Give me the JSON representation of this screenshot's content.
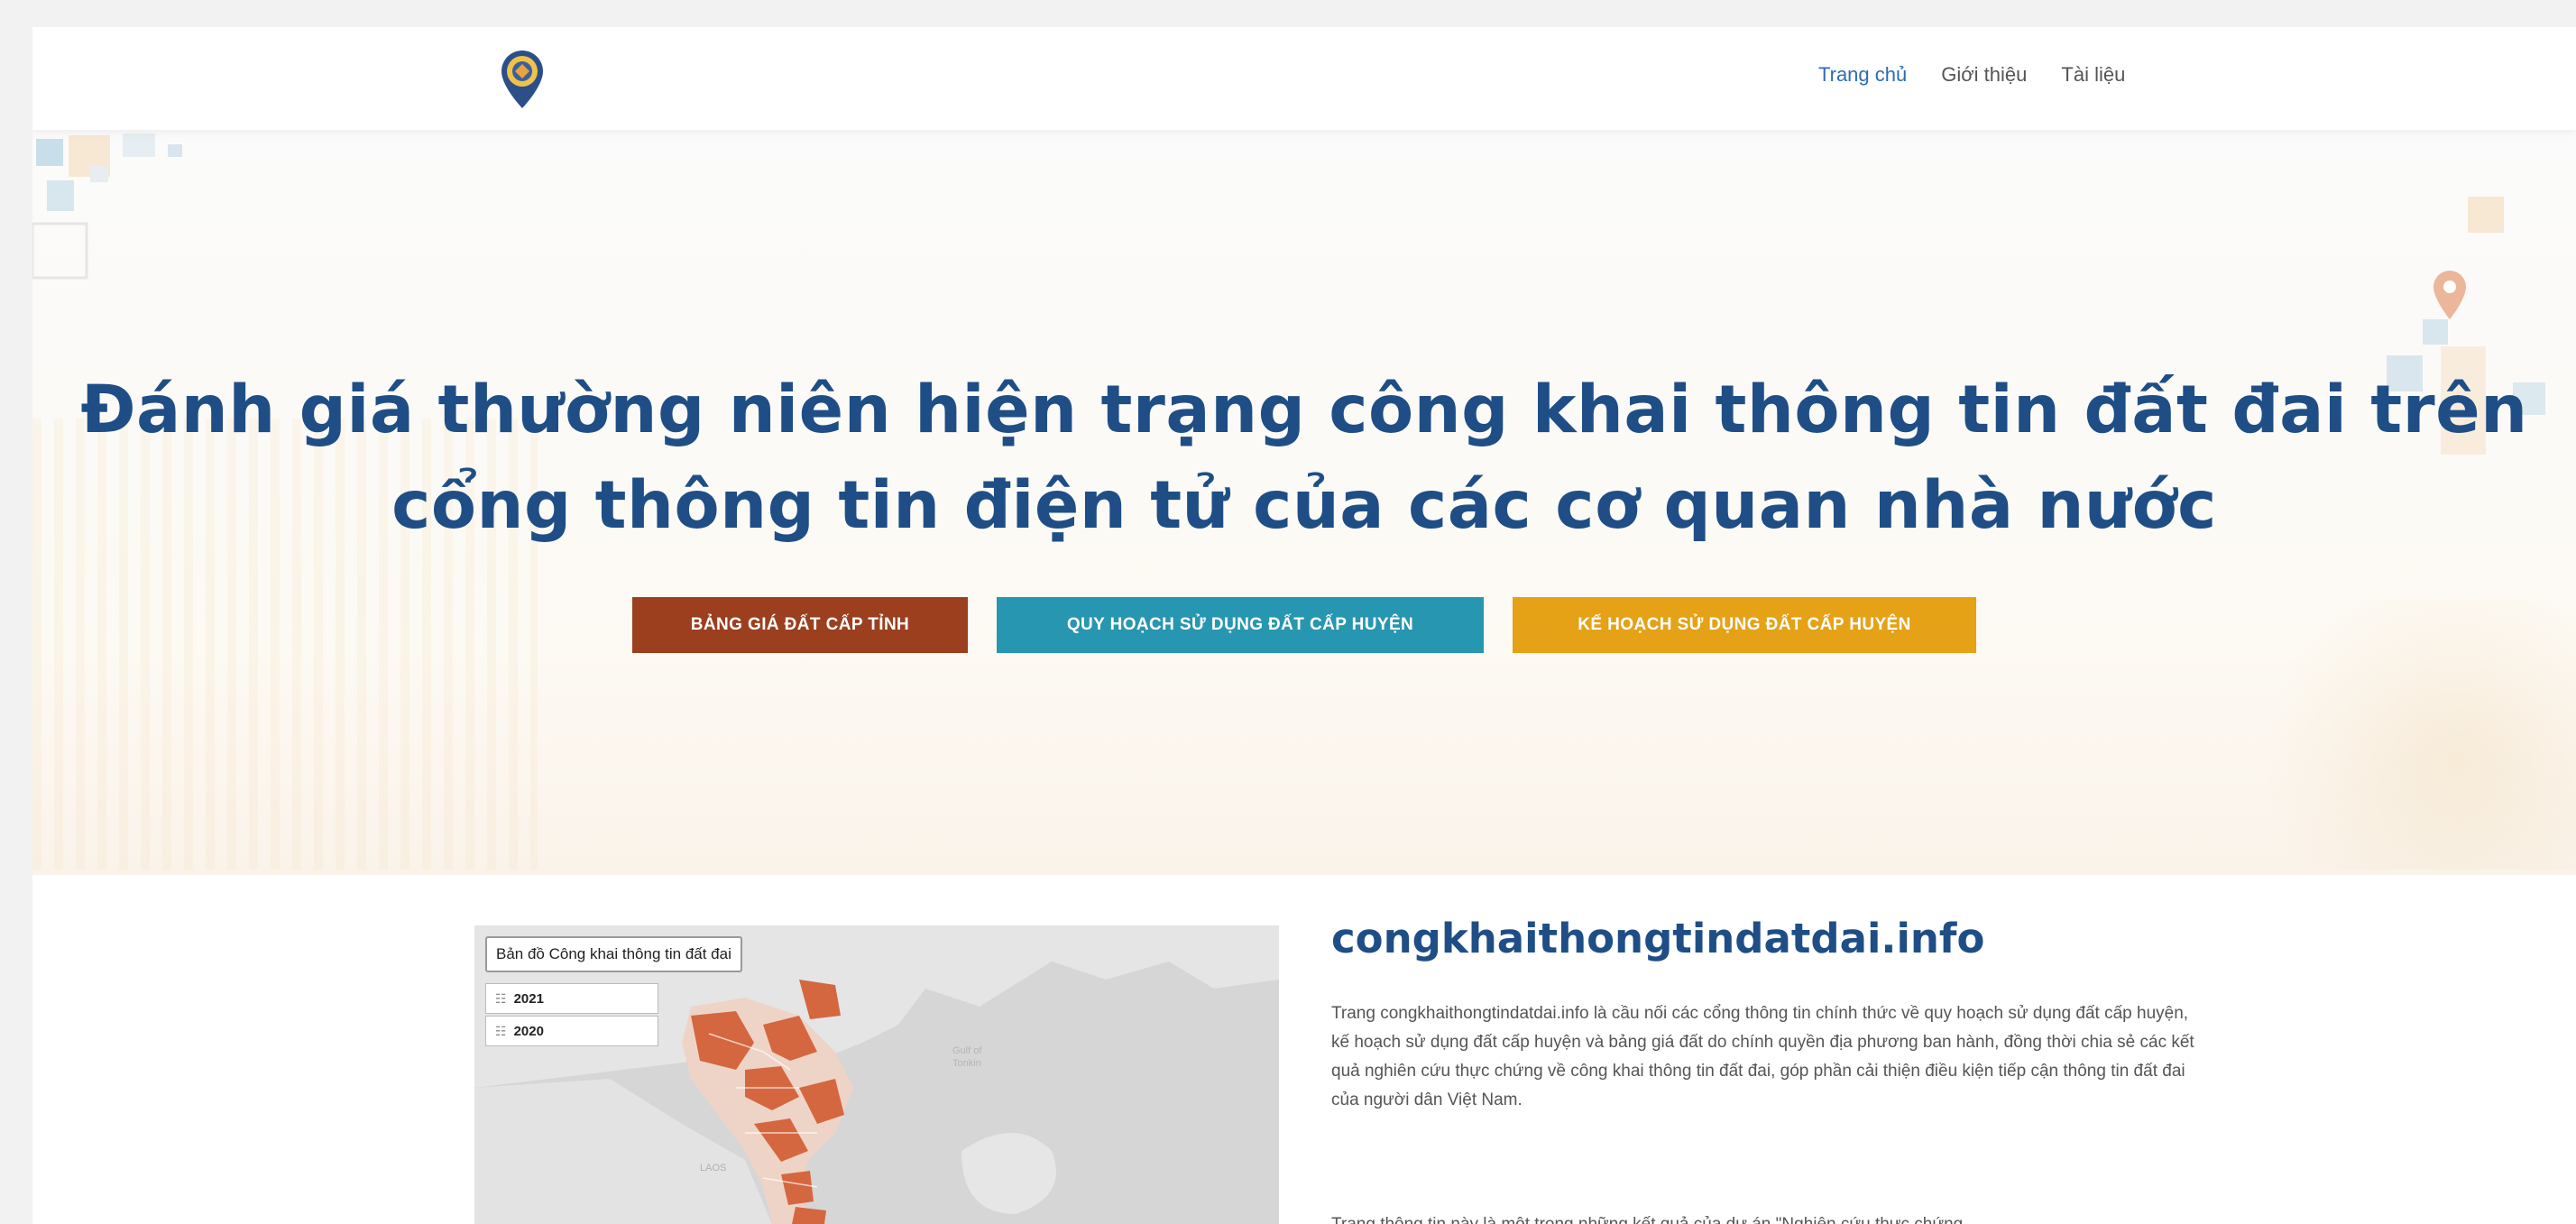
{
  "nav": {
    "items": [
      {
        "label": "Trang chủ",
        "active": true
      },
      {
        "label": "Giới thiệu",
        "active": false
      },
      {
        "label": "Tài liệu",
        "active": false
      }
    ]
  },
  "hero": {
    "title_line1": "Đánh giá thường niên hiện trạng công khai thông tin đất đai trên",
    "title_line2": "cổng thông tin điện tử của các cơ quan nhà nước",
    "buttons": [
      {
        "label": "BẢNG GIÁ ĐẤT CẤP TỈNH",
        "color": "#9b3f1f"
      },
      {
        "label": "QUY HOẠCH SỬ DỤNG ĐẤT CẤP HUYỆN",
        "color": "#2796b1"
      },
      {
        "label": "KẾ HOẠCH SỬ DỤNG ĐẤT CẤP HUYỆN",
        "color": "#e5a217"
      }
    ]
  },
  "map": {
    "title": "Bản đồ Công khai thông tin đất đai",
    "layers": [
      {
        "label": "2021",
        "icon": "layers-icon"
      },
      {
        "label": "2020",
        "icon": "layers-icon"
      }
    ],
    "highlight_color": "#d4673f"
  },
  "content": {
    "site_title": "congkhaithongtindatdai.info",
    "paragraph1": "Trang congkhaithongtindatdai.info là cầu nối các cổng thông tin chính thức về quy hoạch sử dụng đất cấp huyện, kế hoạch sử dụng đất cấp huyện và bảng giá đất do chính quyền địa phương ban hành, đồng thời chia sẻ các kết quả nghiên cứu thực chứng về công khai thông tin đất đai, góp phần cải thiện điều kiện tiếp cận thông tin đất đai của người dân Việt Nam.",
    "paragraph2": "Trang thông tin này là một trong những kết quả của dự án \"Nghiên cứu thực chứng"
  },
  "colors": {
    "primary": "#1f4e86",
    "nav_active": "#2b6cb8"
  }
}
